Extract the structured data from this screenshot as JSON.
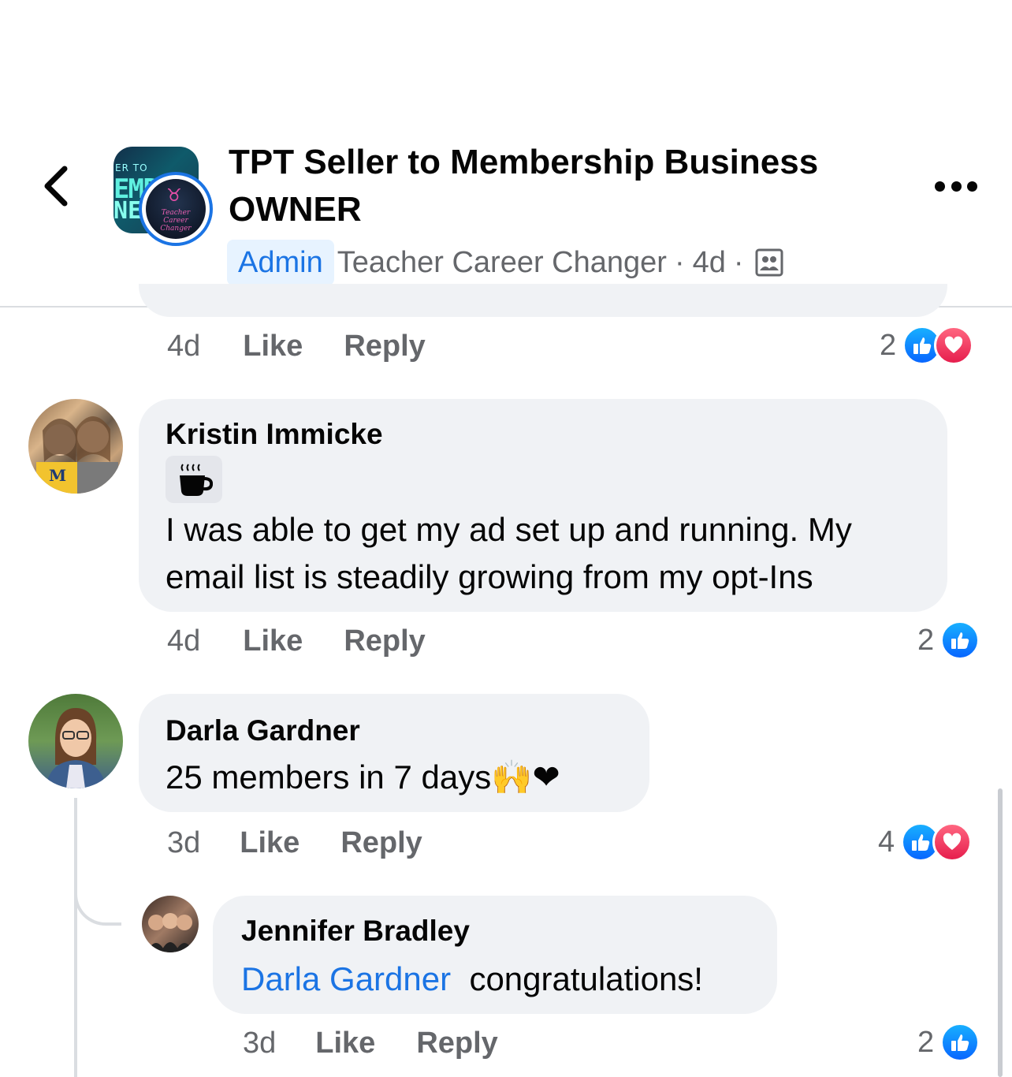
{
  "header": {
    "title": "TPT Seller to Membership Business OWNER",
    "admin_badge": "Admin",
    "author": "Teacher Career Changer",
    "time": "4d",
    "group_avatar_text": [
      "ER TO",
      "EMPI",
      "NE"
    ],
    "admin_avatar_caption": "Teacher Career Changer"
  },
  "top_reply": {
    "time": "4d",
    "like_label": "Like",
    "reply_label": "Reply",
    "reaction_count": "2",
    "reactions": [
      "like",
      "love"
    ]
  },
  "comments": [
    {
      "author": "Kristin Immicke",
      "sticker": "coffee-cup",
      "text_line1": "I was able to get my ad set up and running. My",
      "text_line2": "email list is steadily growing from my opt-Ins",
      "time": "4d",
      "like_label": "Like",
      "reply_label": "Reply",
      "reaction_count": "2",
      "reactions": [
        "like"
      ]
    },
    {
      "author": "Darla Gardner",
      "text": "25 members in 7 days",
      "emojis": "🙌❤",
      "time": "3d",
      "like_label": "Like",
      "reply_label": "Reply",
      "reaction_count": "4",
      "reactions": [
        "like",
        "love"
      ]
    }
  ],
  "reply": {
    "author": "Jennifer Bradley",
    "mention": "Darla Gardner",
    "text": "congratulations!",
    "time": "3d",
    "like_label": "Like",
    "reply_label": "Reply",
    "reaction_count": "2",
    "reactions": [
      "like"
    ]
  },
  "colors": {
    "accent": "#1b74e4",
    "bubble": "#f0f2f5",
    "secondary_text": "#65676b",
    "like": "#0866ff",
    "love": "#e61e4d"
  }
}
